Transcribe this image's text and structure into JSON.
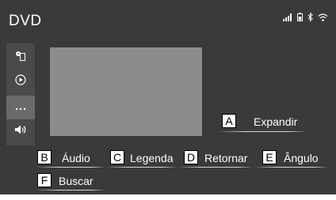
{
  "header": {
    "title": "DVD"
  },
  "status_icons": [
    "signal-icon",
    "battery-icon",
    "bluetooth-icon",
    "wifi-icon"
  ],
  "sidebar": {
    "items": [
      "disc-source-icon",
      "play-icon",
      "more-icon",
      "volume-icon"
    ],
    "active": "more-icon"
  },
  "buttons": {
    "expand": {
      "letter": "A",
      "label": "Expandir"
    },
    "audio": {
      "letter": "B",
      "label": "Áudio"
    },
    "subtitle": {
      "letter": "C",
      "label": "Legenda"
    },
    "back": {
      "letter": "D",
      "label": "Retornar"
    },
    "angle": {
      "letter": "E",
      "label": "Ângulo"
    },
    "search": {
      "letter": "F",
      "label": "Buscar"
    }
  },
  "colors": {
    "screen_bg": "#3a3a3a",
    "sidebar_bg": "#4a4a4a",
    "video_area": "#8c8c8c",
    "text": "#ffffff"
  }
}
